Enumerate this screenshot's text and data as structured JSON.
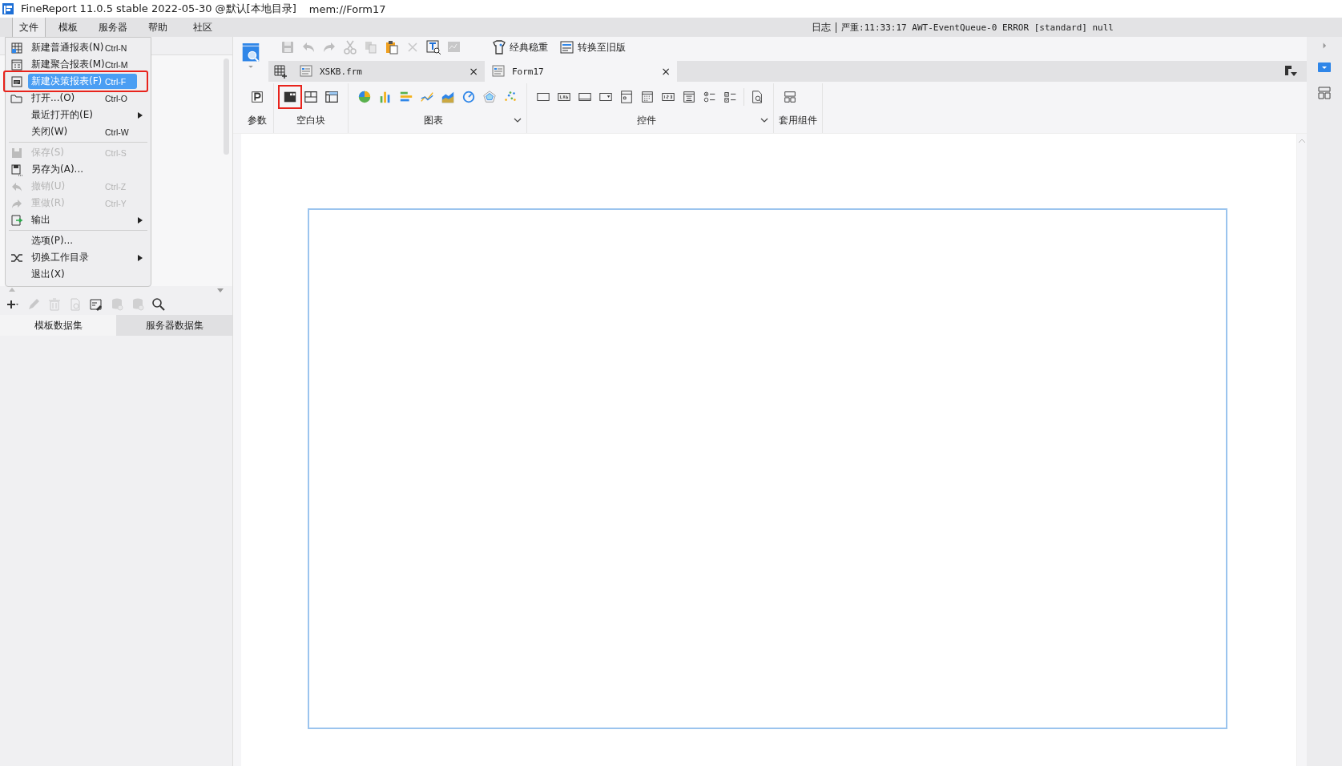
{
  "window": {
    "title": "FineReport 11.0.5 stable 2022-05-30 @默认[本地目录]",
    "path": "mem://Form17"
  },
  "menu_bar": {
    "items": [
      {
        "label": "文件",
        "selected": true
      },
      {
        "label": "模板",
        "selected": false
      },
      {
        "label": "服务器",
        "selected": false
      },
      {
        "label": "帮助",
        "selected": false
      },
      {
        "label": "社区",
        "selected": false
      }
    ],
    "log_label": "日志",
    "log_message": "严重:11:33:17 AWT-EventQueue-0 ERROR [standard] null"
  },
  "file_menu": {
    "items": [
      {
        "kind": "item",
        "label": "新建普通报表(N)",
        "shortcut": "Ctrl-N",
        "disabled": false,
        "selected": false,
        "submenu": false,
        "annotated": false
      },
      {
        "kind": "item",
        "label": "新建聚合报表(M)",
        "shortcut": "Ctrl-M",
        "disabled": false,
        "selected": false,
        "submenu": false,
        "annotated": false
      },
      {
        "kind": "item",
        "label": "新建决策报表(F)",
        "shortcut": "Ctrl-F",
        "disabled": false,
        "selected": true,
        "submenu": false,
        "annotated": true
      },
      {
        "kind": "item",
        "label": "打开...(O)",
        "shortcut": "Ctrl-O",
        "disabled": false,
        "selected": false,
        "submenu": false,
        "annotated": false
      },
      {
        "kind": "item",
        "label": "最近打开的(E)",
        "disabled": false,
        "selected": false,
        "submenu": true,
        "annotated": false
      },
      {
        "kind": "item",
        "label": "关闭(W)",
        "shortcut": "Ctrl-W",
        "disabled": false,
        "selected": false,
        "submenu": false,
        "annotated": false
      },
      {
        "kind": "separator"
      },
      {
        "kind": "item",
        "label": "保存(S)",
        "shortcut": "Ctrl-S",
        "disabled": true,
        "selected": false,
        "submenu": false,
        "annotated": false
      },
      {
        "kind": "item",
        "label": "另存为(A)...",
        "disabled": false,
        "selected": false,
        "submenu": false,
        "annotated": false
      },
      {
        "kind": "item",
        "label": "撤销(U)",
        "shortcut": "Ctrl-Z",
        "disabled": true,
        "selected": false,
        "submenu": false,
        "annotated": false
      },
      {
        "kind": "item",
        "label": "重做(R)",
        "shortcut": "Ctrl-Y",
        "disabled": true,
        "selected": false,
        "submenu": false,
        "annotated": false
      },
      {
        "kind": "item",
        "label": "输出",
        "disabled": false,
        "selected": false,
        "submenu": true,
        "annotated": false
      },
      {
        "kind": "separator"
      },
      {
        "kind": "item",
        "label": "选项(P)...",
        "disabled": false,
        "selected": false,
        "submenu": false,
        "annotated": false
      },
      {
        "kind": "item",
        "label": "切换工作目录",
        "disabled": false,
        "selected": false,
        "submenu": true,
        "annotated": false
      },
      {
        "kind": "item",
        "label": "退出(X)",
        "disabled": false,
        "selected": false,
        "submenu": false,
        "annotated": false
      }
    ]
  },
  "toolbar": {
    "icons": [
      {
        "disabled": true
      },
      {
        "disabled": true
      },
      {
        "disabled": true
      },
      {
        "disabled": true
      },
      {
        "disabled": true
      },
      {
        "disabled": false
      },
      {
        "disabled": true
      },
      {
        "disabled": false
      },
      {
        "disabled": true
      }
    ],
    "buttons": [
      {
        "label": "经典稳重"
      },
      {
        "label": "转换至旧版"
      }
    ]
  },
  "tabs": [
    {
      "label": "XSKB.frm",
      "close": "×",
      "selected": false
    },
    {
      "label": "Form17",
      "close": "×",
      "selected": true
    }
  ],
  "widget_bar": {
    "groups": [
      {
        "label": "参数",
        "expandable": false,
        "icons": [
          {
            "annotated": false
          }
        ]
      },
      {
        "label": "空白块",
        "expandable": false,
        "icons": [
          {
            "annotated": true
          },
          {
            "annotated": false
          },
          {
            "annotated": false
          }
        ]
      },
      {
        "label": "图表",
        "expandable": true,
        "icons": [
          {
            "annotated": false
          },
          {
            "annotated": false
          },
          {
            "annotated": false
          },
          {
            "annotated": false
          },
          {
            "annotated": false
          },
          {
            "annotated": false
          },
          {
            "annotated": false
          },
          {
            "annotated": false
          }
        ]
      },
      {
        "label": "控件",
        "expandable": true,
        "icons": [
          {
            "annotated": false
          },
          {
            "annotated": false
          },
          {
            "annotated": false
          },
          {
            "annotated": false
          },
          {
            "annotated": false
          },
          {
            "annotated": false
          },
          {
            "annotated": false
          },
          {
            "annotated": false
          },
          {
            "annotated": false
          },
          {
            "annotated": false
          },
          {
            "annotated": false
          }
        ]
      },
      {
        "label": "套用组件",
        "expandable": false,
        "icons": [
          {
            "annotated": false
          }
        ]
      }
    ]
  },
  "data_panel": {
    "tools": [
      {
        "disabled": false
      },
      {
        "disabled": true
      },
      {
        "disabled": true
      },
      {
        "disabled": true
      },
      {
        "disabled": false
      },
      {
        "disabled": true
      },
      {
        "disabled": true
      },
      {
        "disabled": false
      }
    ],
    "tabs": [
      {
        "label": "模板数据集",
        "selected": true
      },
      {
        "label": "服务器数据集",
        "selected": false
      }
    ]
  }
}
